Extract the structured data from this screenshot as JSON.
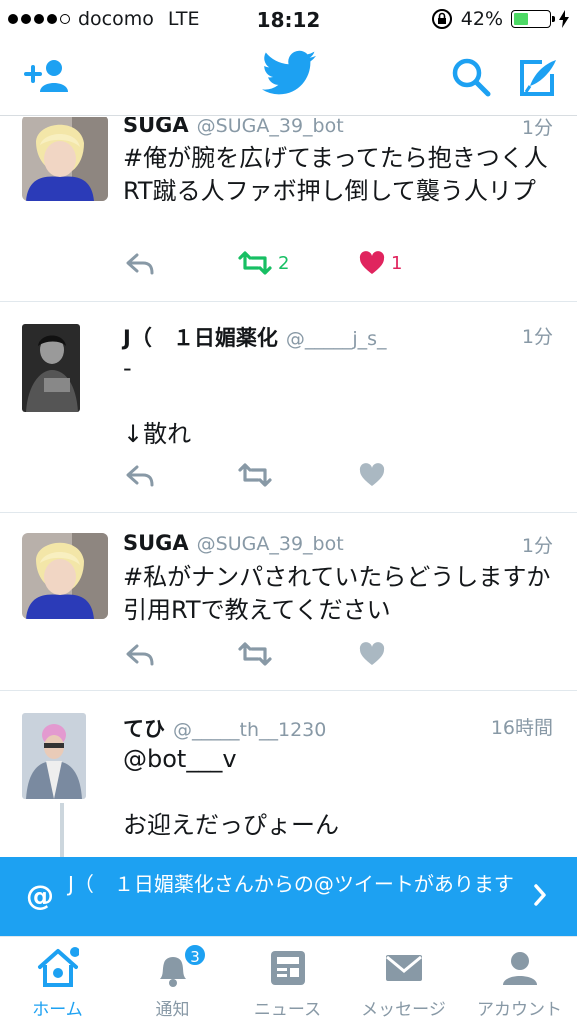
{
  "status_bar": {
    "carrier": "docomo",
    "network": "LTE",
    "time": "18:12",
    "battery": "42%",
    "battery_level": 0.42
  },
  "navbar": {
    "icons": [
      "add-user-icon",
      "twitter-bird-icon",
      "search-icon",
      "compose-icon"
    ],
    "accent": "#1da1f2"
  },
  "tweets": [
    {
      "name": "SUGA",
      "handle": "@SUGA_39_bot",
      "time": "1分",
      "text": "#俺が腕を広げてまってたら抱きつく人RT蹴る人ファボ押し倒して襲う人リプ",
      "retweets": "2",
      "likes": "1",
      "retweeted": true,
      "liked": true
    },
    {
      "name": "J（　１日媚薬化",
      "handle": "@_____j_s_",
      "time": "1分",
      "text": "-\n\n↓散れ",
      "retweets": "",
      "likes": ""
    },
    {
      "name": "SUGA",
      "handle": "@SUGA_39_bot",
      "time": "1分",
      "text": "#私がナンパされていたらどうしますか引用RTで教えてください",
      "retweets": "",
      "likes": ""
    },
    {
      "name": "てひ",
      "handle": "@_____th__1230",
      "time": "16時間",
      "text": "@bot___v\n\nお迎えだっぴょーん"
    }
  ],
  "banner": {
    "symbol": "@",
    "message": "J（　１日媚薬化さんからの@ツイートがあります"
  },
  "tabs": [
    {
      "label": "ホーム",
      "icon": "home-icon",
      "active": true
    },
    {
      "label": "通知",
      "icon": "bell-icon",
      "badge": "3"
    },
    {
      "label": "ニュース",
      "icon": "news-icon"
    },
    {
      "label": "メッセージ",
      "icon": "envelope-icon"
    },
    {
      "label": "アカウント",
      "icon": "person-icon"
    }
  ],
  "colors": {
    "accent": "#1da1f2",
    "retweet": "#17bf63",
    "like": "#e0245e",
    "muted": "#8899a6"
  }
}
